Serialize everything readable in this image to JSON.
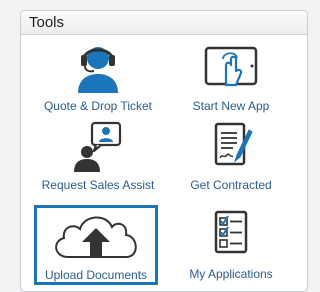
{
  "panel": {
    "title": "Tools",
    "tiles": [
      {
        "label": "Quote & Drop Ticket",
        "icon": "headset-agent-icon"
      },
      {
        "label": "Start New App",
        "icon": "tablet-touch-icon"
      },
      {
        "label": "Request Sales Assist",
        "icon": "person-chat-icon"
      },
      {
        "label": "Get Contracted",
        "icon": "contract-signature-icon"
      },
      {
        "label": "Upload Documents",
        "icon": "cloud-upload-icon",
        "selected": true
      },
      {
        "label": "My Applications",
        "icon": "checklist-icon"
      }
    ]
  },
  "colors": {
    "accent": "#1b75bb",
    "label": "#2a5d94",
    "icon_dark": "#333333"
  }
}
